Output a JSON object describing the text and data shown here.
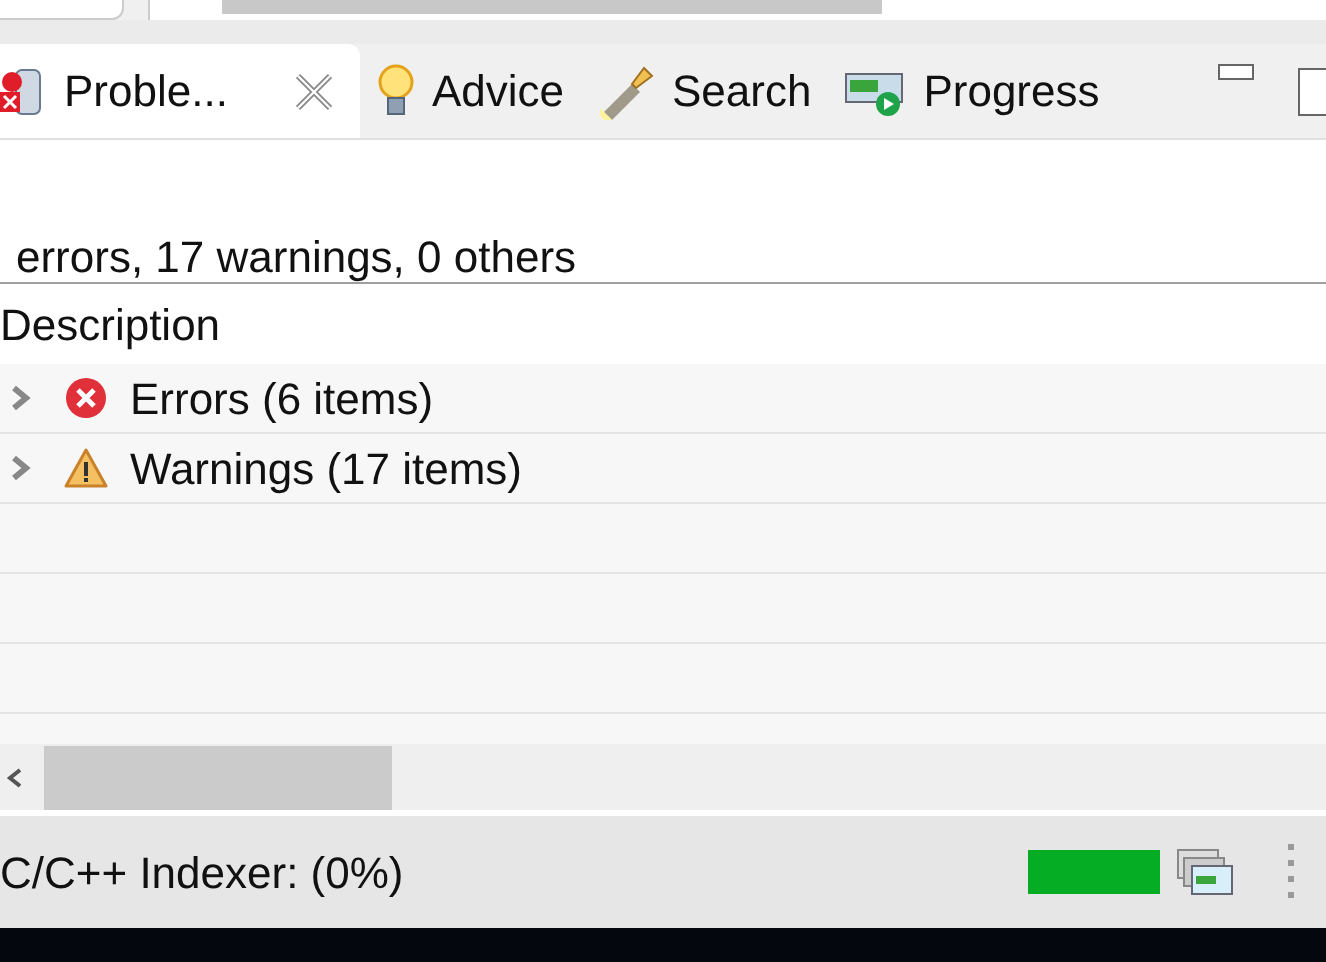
{
  "tabs": [
    {
      "label": "Proble...",
      "kind": "problems",
      "selected": true,
      "closable": true
    },
    {
      "label": "Advice",
      "kind": "advice",
      "selected": false,
      "closable": false
    },
    {
      "label": "Search",
      "kind": "search",
      "selected": false,
      "closable": false
    },
    {
      "label": "Progress",
      "kind": "progress",
      "selected": false,
      "closable": false
    }
  ],
  "summary": "errors, 17 warnings, 0 others",
  "table": {
    "columns": [
      "Description"
    ],
    "rows": [
      {
        "label": "Errors (6 items)",
        "kind": "error",
        "expanded": false
      },
      {
        "label": "Warnings (17 items)",
        "kind": "warning",
        "expanded": false
      }
    ]
  },
  "status_bar": {
    "text": "C/C++ Indexer: (0%)",
    "progress": {
      "level": 1
    }
  }
}
